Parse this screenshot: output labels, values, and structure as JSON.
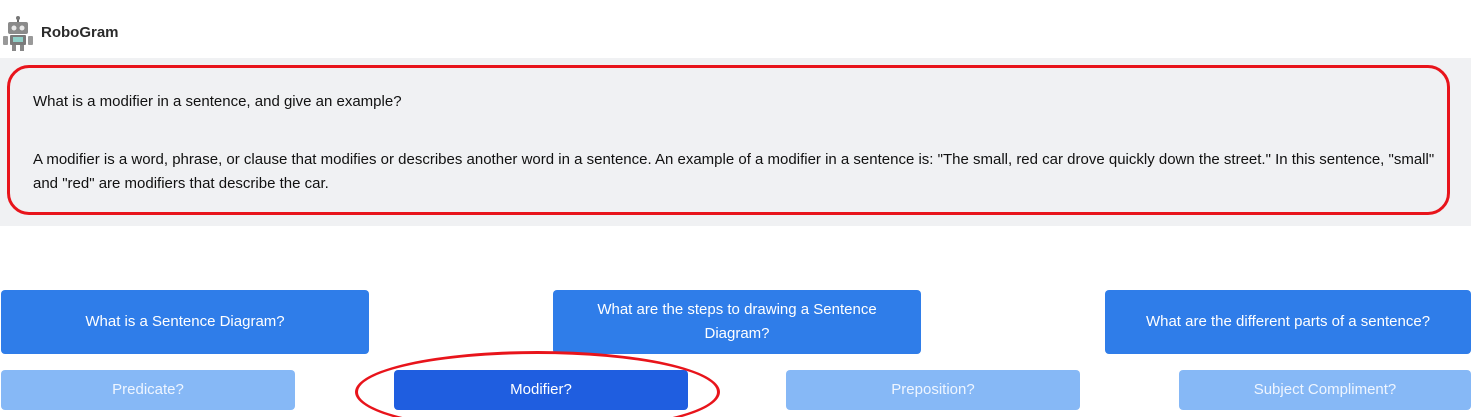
{
  "app": {
    "title": "RoboGram",
    "avatar_icon": "robot-icon"
  },
  "chat": {
    "question": "What is a modifier in a sentence, and give an example?",
    "answer": "A modifier is a word, phrase, or clause that modifies or describes another word in a sentence. An example of a modifier in a sentence is: \"The small, red car drove quickly down the street.\" In this sentence, \"small\" and \"red\" are modifiers that describe the car."
  },
  "suggestions": {
    "primary": [
      "What is a Sentence Diagram?",
      "What are the steps to drawing a Sentence Diagram?",
      "What are the different parts of a sentence?"
    ],
    "secondary": [
      "Predicate?",
      "Modifier?",
      "Preposition?",
      "Subject Compliment?"
    ]
  },
  "colors": {
    "highlight": "#e8141b",
    "primary_button": "#2f7de9",
    "light_button": "#86b8f6",
    "active_button": "#1f5ee0"
  }
}
